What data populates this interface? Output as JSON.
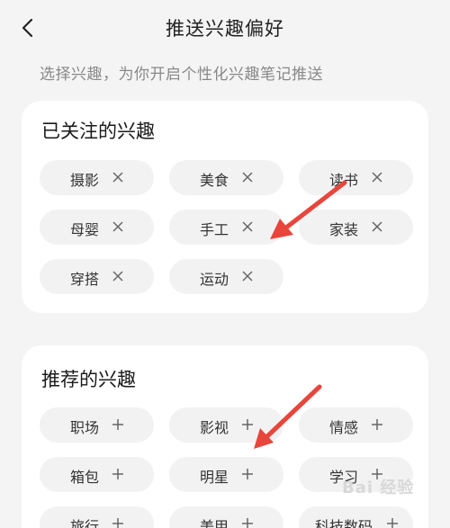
{
  "header": {
    "title": "推送兴趣偏好",
    "back_icon": "chevron-left-icon"
  },
  "subtitle": "选择兴趣，为你开启个性化兴趣笔记推送",
  "followed": {
    "title": "已关注的兴趣",
    "action_icon": "close-icon",
    "tags": [
      "摄影",
      "美食",
      "读书",
      "母婴",
      "手工",
      "家装",
      "穿搭",
      "运动"
    ]
  },
  "recommended": {
    "title": "推荐的兴趣",
    "action_icon": "plus-icon",
    "tags": [
      "职场",
      "影视",
      "情感",
      "箱包",
      "明星",
      "学习",
      "旅行",
      "美甲",
      "科技数码"
    ]
  },
  "annotations": {
    "arrow_color": "#e8453c"
  },
  "watermark": "Bai 经验"
}
